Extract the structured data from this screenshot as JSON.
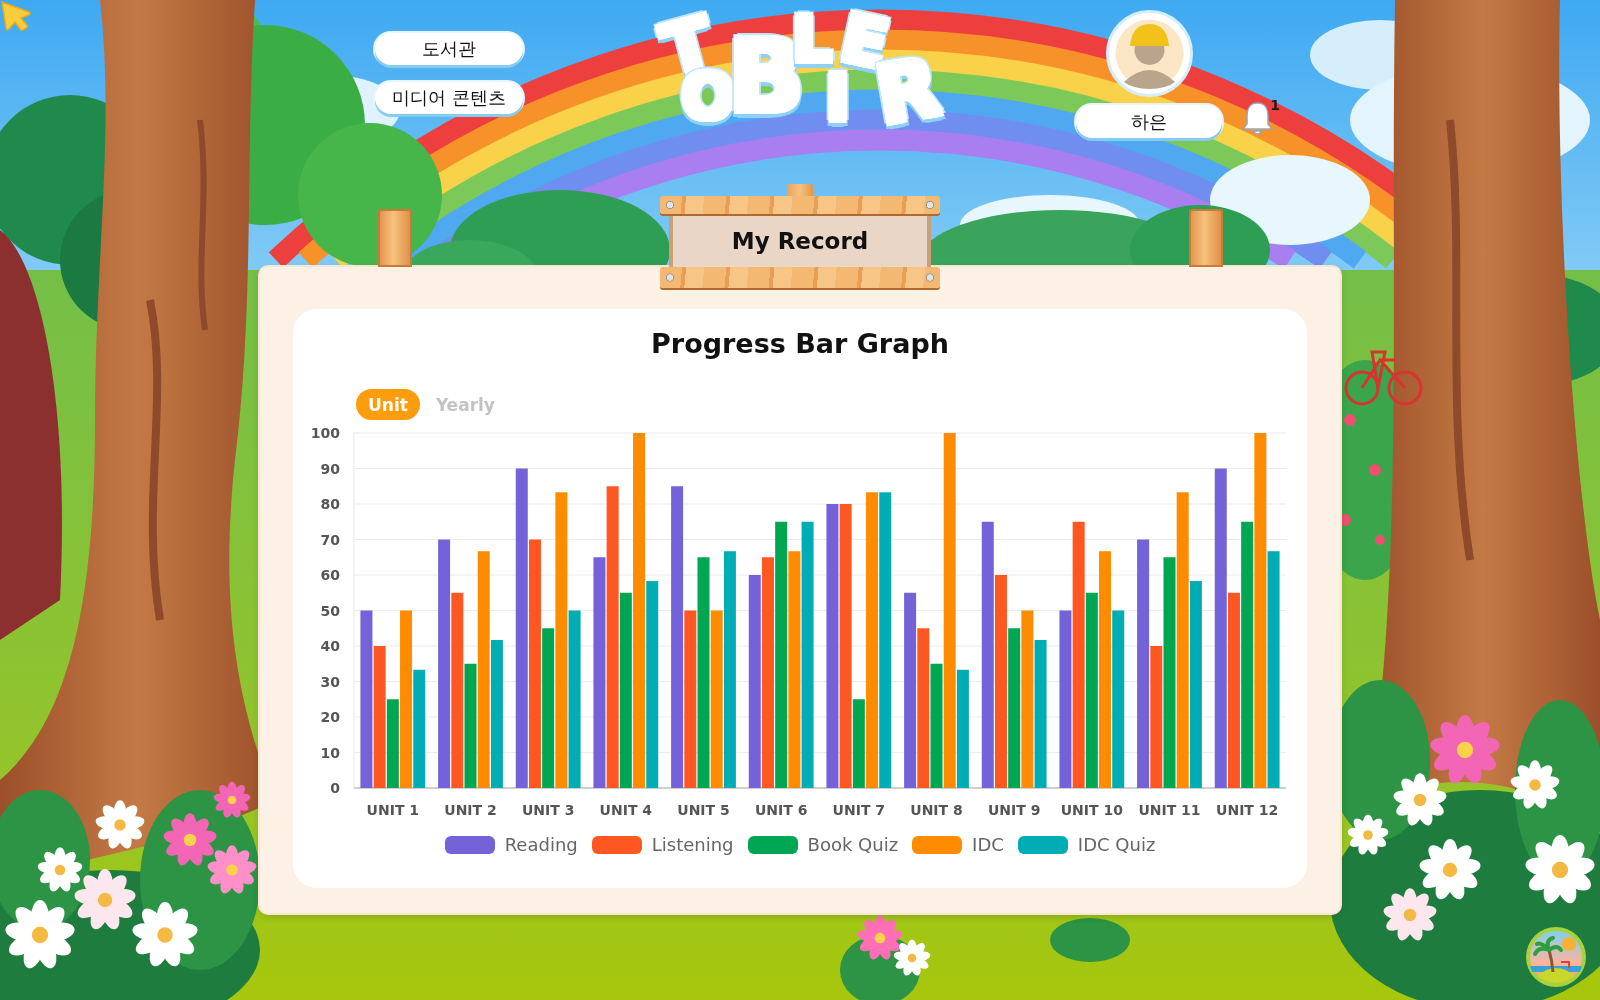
{
  "header": {
    "menu": [
      {
        "label": "도서관"
      },
      {
        "label": "미디어 콘텐츠"
      }
    ],
    "logo": "TOBLIER",
    "user": {
      "name": "하은"
    },
    "notifications": {
      "count": "1"
    }
  },
  "sign": {
    "title": "My Record"
  },
  "card": {
    "title": "Progress Bar Graph",
    "tabs": [
      {
        "label": "Unit",
        "selected": true
      },
      {
        "label": "Yearly",
        "selected": false
      }
    ],
    "chart_data": {
      "type": "bar",
      "categories": [
        "UNIT 1",
        "UNIT 2",
        "UNIT 3",
        "UNIT 4",
        "UNIT 5",
        "UNIT 6",
        "UNIT 7",
        "UNIT 8",
        "UNIT 9",
        "UNIT 10",
        "UNIT 11",
        "UNIT 12"
      ],
      "series": [
        {
          "name": "Reading",
          "color": "#7462d8",
          "values": [
            50,
            70,
            90,
            65,
            85,
            60,
            80,
            55,
            75,
            50,
            70,
            90
          ]
        },
        {
          "name": "Listening",
          "color": "#ff5722",
          "values": [
            40,
            55,
            70,
            85,
            50,
            65,
            80,
            45,
            60,
            75,
            40,
            55
          ]
        },
        {
          "name": "Book Quiz",
          "color": "#00a651",
          "values": [
            25,
            35,
            45,
            55,
            65,
            75,
            25,
            35,
            45,
            55,
            65,
            75
          ]
        },
        {
          "name": "IDC",
          "color": "#ff8c00",
          "values": [
            50,
            66.7,
            83.3,
            100,
            50,
            66.7,
            83.3,
            100,
            50,
            66.7,
            83.3,
            100
          ]
        },
        {
          "name": "IDC Quiz",
          "color": "#00adb5",
          "values": [
            33.3,
            41.7,
            50,
            58.3,
            66.7,
            75,
            83.3,
            33.3,
            41.7,
            50,
            58.3,
            66.7
          ]
        }
      ],
      "ylim": [
        0,
        100
      ],
      "yticks": [
        0,
        10,
        20,
        30,
        40,
        50,
        60,
        70,
        80,
        90,
        100
      ],
      "grid": true,
      "legend": "bottom"
    }
  }
}
